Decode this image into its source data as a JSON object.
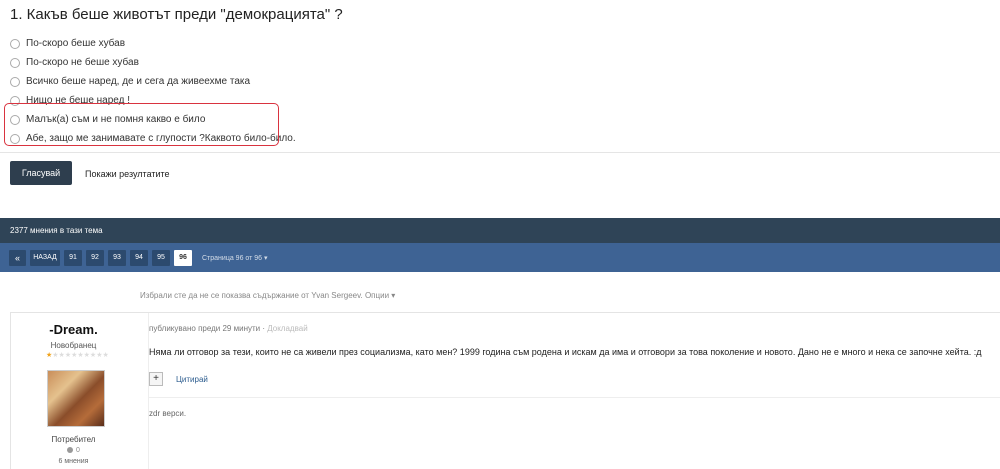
{
  "poll": {
    "title": "1. Какъв беше животът преди \"демокрацията\" ?",
    "options": [
      "По-скоро беше хубав",
      "По-скоро не беше хубав",
      "Всичко беше наред, де и сега да живеехме така",
      "Нищо не беше наред !",
      "Малък(а) съм и не помня какво е било",
      "Абе, защо ме занимавате с глупости ?Каквото било-било."
    ],
    "vote_label": "Гласувай",
    "results_label": "Покажи резултатите",
    "highlight_color": "#d9333f"
  },
  "topic": {
    "count_label": "2377 мнения в тази тема",
    "header_color": "#2f4457",
    "pager_color": "#3e6394"
  },
  "pagination": {
    "first_label": "«",
    "prev_label": "НАЗАД",
    "pages": [
      "91",
      "92",
      "93",
      "94",
      "95",
      "96"
    ],
    "current_page": "96",
    "page_info": "Страница 96 от 96 ▾"
  },
  "ignore_note": "Избрали сте да не се показва съдържание от Yvan Sergeev. Опции ▾",
  "post": {
    "author": "-Dream.",
    "rank": "Новобранец",
    "group": "Потребител",
    "reputation": "0",
    "posts_count": "6 мнения",
    "rating_stars": 1,
    "meta": "публикувано преди 29 минути ·",
    "edited_label": "Докладвай",
    "text": "Няма ли отговор за тези, които не са живели през социализма, като мен? 1999 година съм родена и искам да има и отговори за това поколение и новото. Дано не е много и нека се започне хейта. :д",
    "quote_icon": "plus-icon",
    "quote_label": "Цитирай",
    "signature": "zdr верси."
  }
}
